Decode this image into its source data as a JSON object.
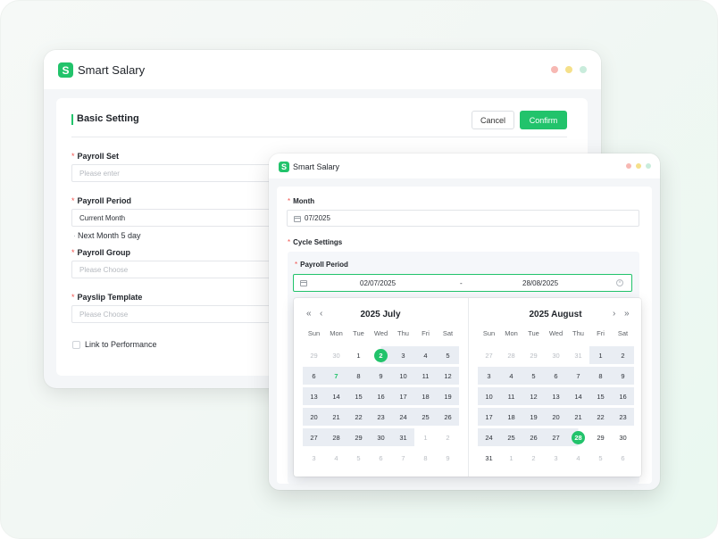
{
  "app": {
    "title": "Smart Salary",
    "logo_letter": "S"
  },
  "back_window": {
    "section_title": "Basic Setting",
    "cancel_label": "Cancel",
    "confirm_label": "Confirm",
    "required_mark": "*",
    "payroll_set": {
      "label": "Payroll Set",
      "placeholder": "Please enter"
    },
    "payroll_period": {
      "label": "Payroll Period",
      "value": "Current Month",
      "note": "Next Month 5 day"
    },
    "payroll_group": {
      "label": "Payroll Group",
      "placeholder": "Please Choose"
    },
    "payslip_template": {
      "label": "Payslip Template",
      "placeholder": "Please Choose"
    },
    "link_performance": {
      "label": "Link to Performance",
      "checked": false
    }
  },
  "front_window": {
    "month": {
      "label": "Month",
      "value": "07/2025"
    },
    "cycle_settings_label": "Cycle Settings",
    "payroll_period": {
      "label": "Payroll Period",
      "start": "02/07/2025",
      "separator": "-",
      "end": "28/08/2025"
    },
    "calendar": {
      "weekdays": [
        "Sun",
        "Mon",
        "Tue",
        "Wed",
        "Thu",
        "Fri",
        "Sat"
      ],
      "nav": {
        "prev_year": "«",
        "prev_month": "‹",
        "next_month": "›",
        "next_year": "»"
      },
      "left": {
        "title": "2025 July",
        "days": [
          [
            "29",
            "30",
            "1",
            "2",
            "3",
            "4",
            "5"
          ],
          [
            "6",
            "7",
            "8",
            "9",
            "10",
            "11",
            "12"
          ],
          [
            "13",
            "14",
            "15",
            "16",
            "17",
            "18",
            "19"
          ],
          [
            "20",
            "21",
            "22",
            "23",
            "24",
            "25",
            "26"
          ],
          [
            "27",
            "28",
            "29",
            "30",
            "31",
            "1",
            "2"
          ],
          [
            "3",
            "4",
            "5",
            "6",
            "7",
            "8",
            "9"
          ]
        ]
      },
      "right": {
        "title": "2025 August",
        "days": [
          [
            "27",
            "28",
            "29",
            "30",
            "31",
            "1",
            "2"
          ],
          [
            "3",
            "4",
            "5",
            "6",
            "7",
            "8",
            "9"
          ],
          [
            "10",
            "11",
            "12",
            "13",
            "14",
            "15",
            "16"
          ],
          [
            "17",
            "18",
            "19",
            "20",
            "21",
            "22",
            "23"
          ],
          [
            "24",
            "25",
            "26",
            "27",
            "28",
            "29",
            "30"
          ],
          [
            "31",
            "1",
            "2",
            "3",
            "4",
            "5",
            "6"
          ]
        ]
      }
    }
  },
  "colors": {
    "accent": "#22c36b",
    "range_bg": "#e9edf3",
    "required": "#f0544f"
  }
}
